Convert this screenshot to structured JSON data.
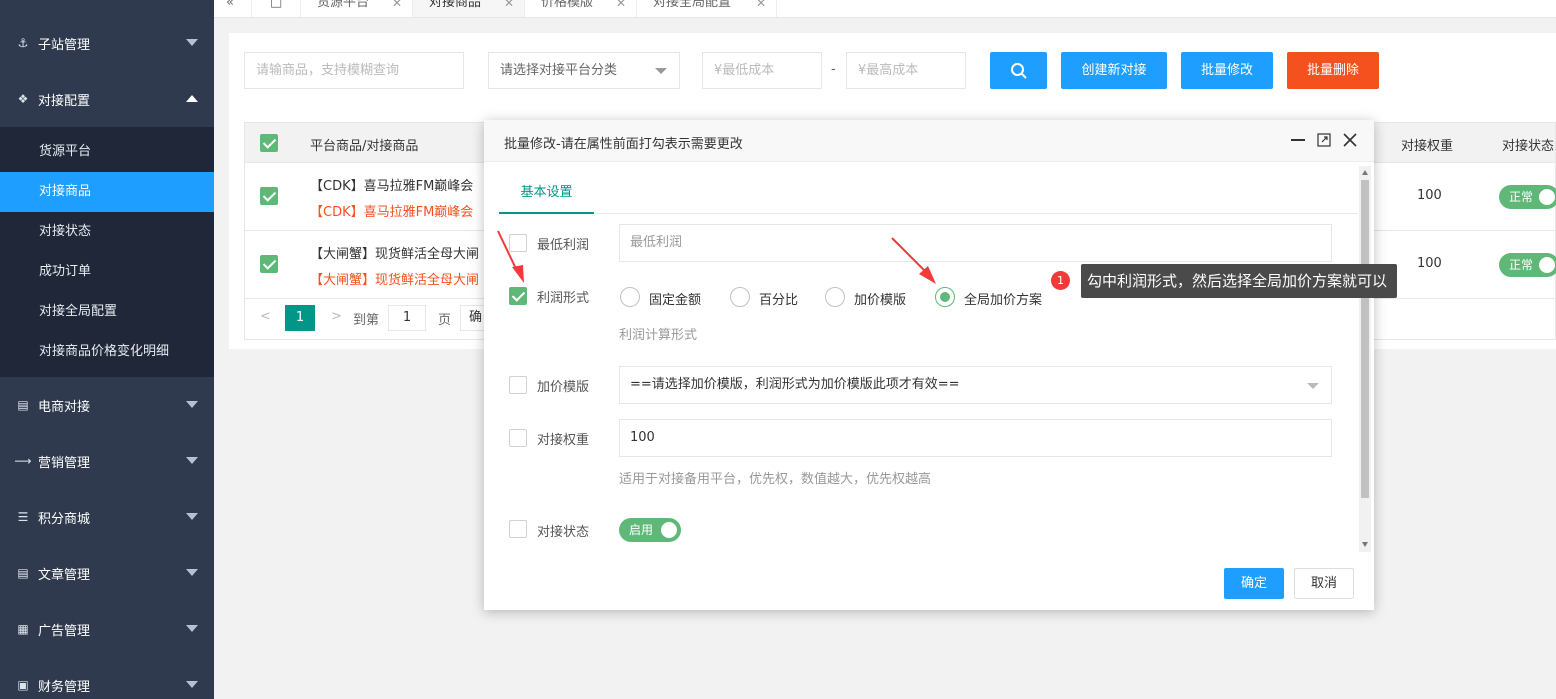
{
  "sidebar": {
    "groups_top": [
      {
        "label": "子站管理",
        "icon": "sitemap-icon"
      }
    ],
    "active_group": {
      "label": "对接配置",
      "icon": "puzzle-icon"
    },
    "sub_items": [
      {
        "label": "货源平台"
      },
      {
        "label": "对接商品"
      },
      {
        "label": "对接状态"
      },
      {
        "label": "成功订单"
      },
      {
        "label": "对接全局配置"
      },
      {
        "label": "对接商品价格变化明细"
      }
    ],
    "groups_bottom": [
      {
        "label": "电商对接"
      },
      {
        "label": "营销管理"
      },
      {
        "label": "积分商城"
      },
      {
        "label": "文章管理"
      },
      {
        "label": "广告管理"
      },
      {
        "label": "财务管理"
      }
    ]
  },
  "tabs": {
    "back": "«",
    "items": [
      "货源平台",
      "对接商品",
      "价格模版",
      "对接全局配置"
    ]
  },
  "toolbar": {
    "search_placeholder": "请输商品，支持模糊查询",
    "category_placeholder": "请选择对接平台分类",
    "min_cost_placeholder": "¥最低成本",
    "dash": "-",
    "max_cost_placeholder": "¥最高成本",
    "create_label": "创建新对接",
    "batch_edit_label": "批量修改",
    "batch_delete_label": "批量删除"
  },
  "table": {
    "col_goods": "平台商品/对接商品",
    "col_weight": "对接权重",
    "col_status": "对接状态",
    "rows": [
      {
        "line1": "【CDK】喜马拉雅FM巅峰会",
        "line2": "【CDK】喜马拉雅FM巅峰会",
        "weight": "100",
        "status": "正常"
      },
      {
        "line1": "【大闸蟹】现货鲜活全母大闸",
        "line2": "【大闸蟹】现货鲜活全母大闸",
        "weight": "100",
        "status": "正常"
      }
    ],
    "pager": {
      "current": "1",
      "goto_label": "到第",
      "page_value": "1",
      "page_unit": "页",
      "confirm": "确"
    }
  },
  "modal": {
    "title": "批量修改-请在属性前面打勾表示需要更改",
    "tab": "基本设置",
    "min_profit_label": "最低利润",
    "min_profit_placeholder": "最低利润",
    "profit_type_label": "利润形式",
    "radios": [
      "固定金额",
      "百分比",
      "加价模版",
      "全局加价方案"
    ],
    "profit_hint": "利润计算形式",
    "markup_label": "加价模版",
    "markup_select": "==请选择加价模版，利润形式为加价模版此项才有效==",
    "weight_label": "对接权重",
    "weight_value": "100",
    "weight_hint": "适用于对接备用平台，优先权，数值越大，优先权越高",
    "status_label": "对接状态",
    "status_switch": "启用",
    "ok": "确定",
    "cancel": "取消"
  },
  "annotation": {
    "badge": "1",
    "tooltip": "勾中利润形式，然后选择全局加价方案就可以"
  },
  "colors": {
    "primary": "#1e9fff",
    "danger": "#f5511e",
    "green": "#5fb878",
    "teal": "#009688",
    "sidebar": "#2f3a4f"
  }
}
